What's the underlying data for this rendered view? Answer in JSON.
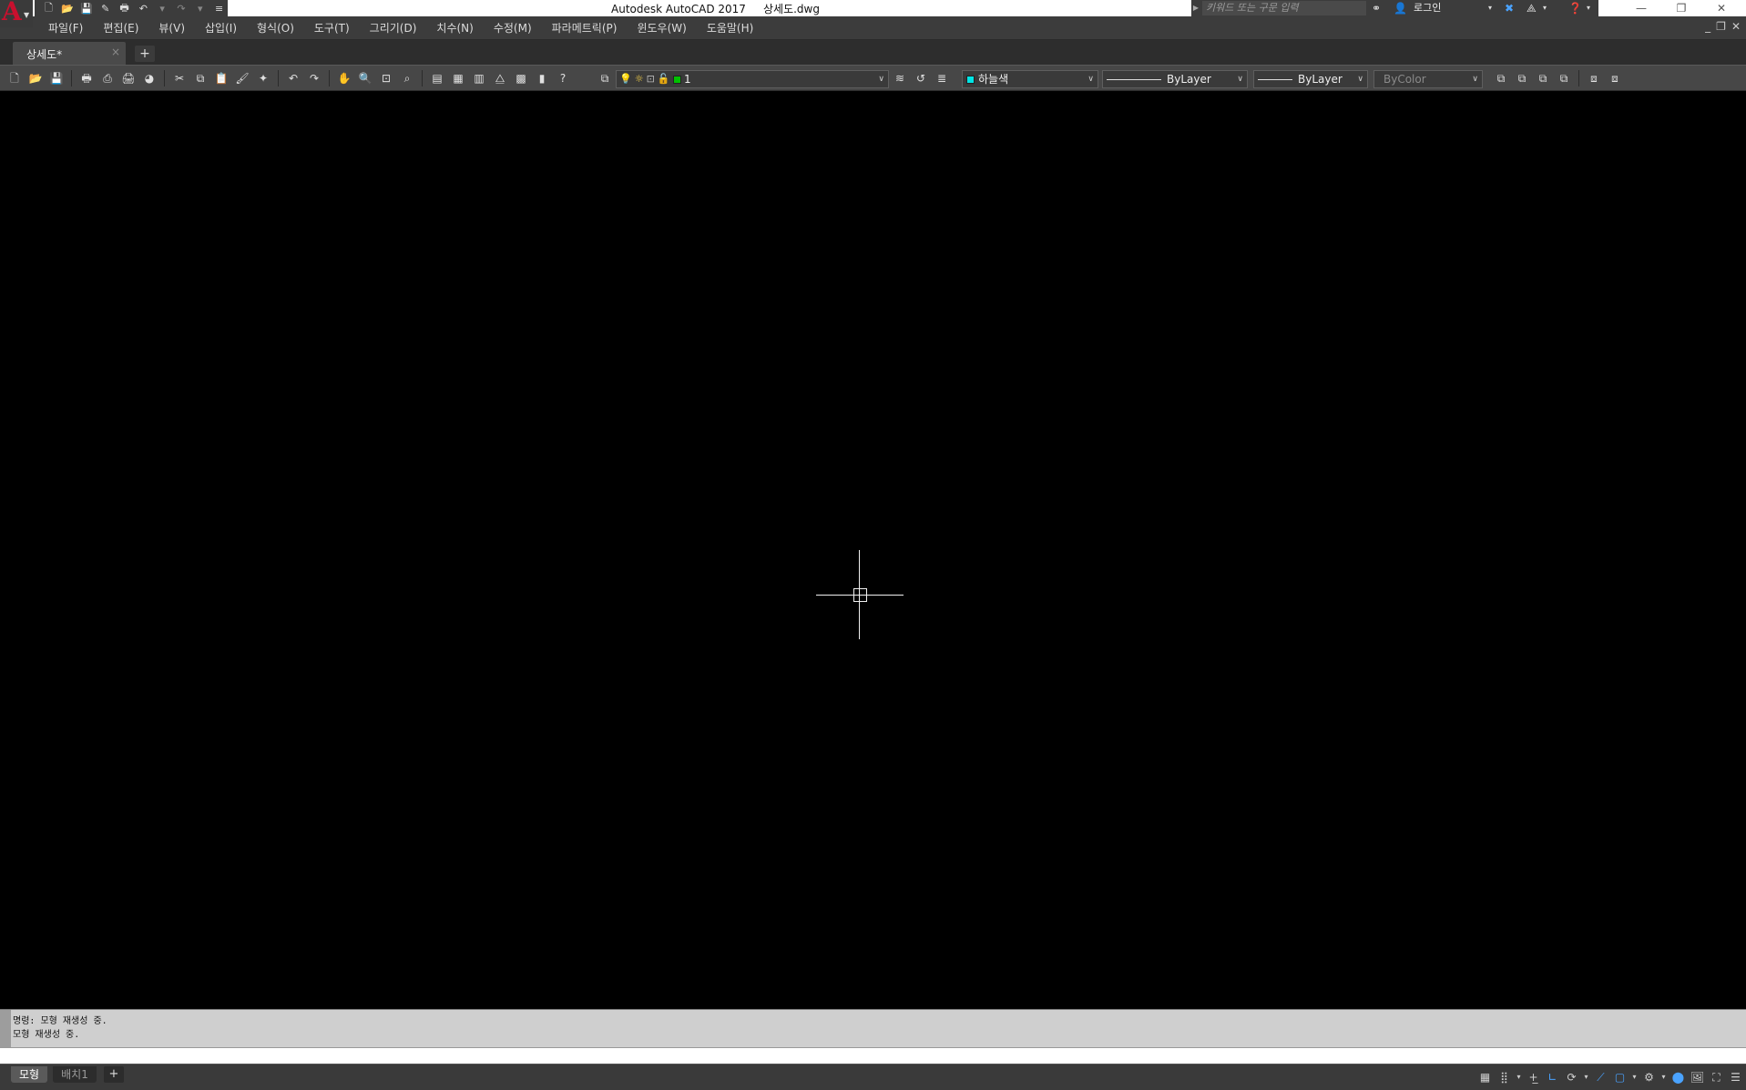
{
  "app": {
    "title": "Autodesk AutoCAD 2017     상세도.dwg",
    "logo_letter": "A"
  },
  "search": {
    "placeholder": "키워드 또는 구문 입력"
  },
  "account": {
    "login_label": "로그인"
  },
  "menu": {
    "items": [
      "파일(F)",
      "편집(E)",
      "뷰(V)",
      "삽입(I)",
      "형식(O)",
      "도구(T)",
      "그리기(D)",
      "치수(N)",
      "수정(M)",
      "파라메트릭(P)",
      "윈도우(W)",
      "도움말(H)"
    ]
  },
  "tabs": {
    "document": "상세도*",
    "close_glyph": "×",
    "add_glyph": "+"
  },
  "toolbar": {
    "layer_value": "1",
    "color_value": "하늘색",
    "color_hex": "#00e5e5",
    "linetype_value": "ByLayer",
    "lineweight_value": "ByLayer",
    "plotstyle_value": "ByColor"
  },
  "command": {
    "history": [
      "명령: 모형 재생성 중.",
      "모형 재생성 중."
    ]
  },
  "layouts": {
    "tabs": [
      "모형",
      "배치1"
    ],
    "add_glyph": "+"
  },
  "colors": {
    "canvas_bg": "#000000",
    "brand_red": "#c8102e",
    "layer_on_green": "#00c000",
    "status_blue": "#4aa3ff"
  }
}
